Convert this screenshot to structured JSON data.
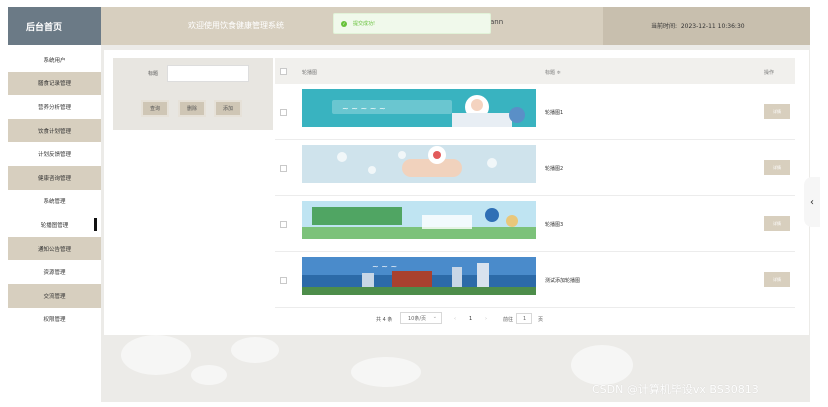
{
  "header": {
    "brand": "后台首页",
    "welcome": "欢迎使用饮食健康管理系统",
    "user": "ann",
    "time_label": "当前时间:",
    "time_value": "2023-12-11 10:36:30",
    "toast": "提交成功!"
  },
  "sidebar": {
    "items": [
      {
        "label": "系统用户"
      },
      {
        "label": "膳食记录管理"
      },
      {
        "label": "营养分析管理"
      },
      {
        "label": "饮食计划管理"
      },
      {
        "label": "计划反馈管理"
      },
      {
        "label": "健康咨询管理"
      },
      {
        "label": "系统管理"
      },
      {
        "label": "轮播图管理"
      },
      {
        "label": "通知公告管理"
      },
      {
        "label": "资源管理"
      },
      {
        "label": "交流管理"
      },
      {
        "label": "权限管理"
      }
    ]
  },
  "search": {
    "title_label": "标题",
    "query_btn": "查询",
    "delete_btn": "删除",
    "add_btn": "添加"
  },
  "table": {
    "col_image": "轮播图",
    "col_title": "标题",
    "col_title_sort": "≑",
    "col_action": "操作",
    "rows": [
      {
        "title": "轮播图1",
        "action": "详情"
      },
      {
        "title": "轮播图2",
        "action": "详情"
      },
      {
        "title": "轮播图3",
        "action": "详情"
      },
      {
        "title": "测试添加轮播图",
        "action": "详情"
      }
    ]
  },
  "pager": {
    "total": "共 4 条",
    "per_page": "10条/页",
    "prev": "‹",
    "current": "1",
    "next": "›",
    "goto": "前往",
    "goto_value": "1",
    "page_unit": "页"
  },
  "watermark": "CSDN @计算机毕设vx BS30813",
  "colors": {
    "beige": "#d7cfbf",
    "slate": "#6b7a86",
    "success": "#67c23a"
  }
}
